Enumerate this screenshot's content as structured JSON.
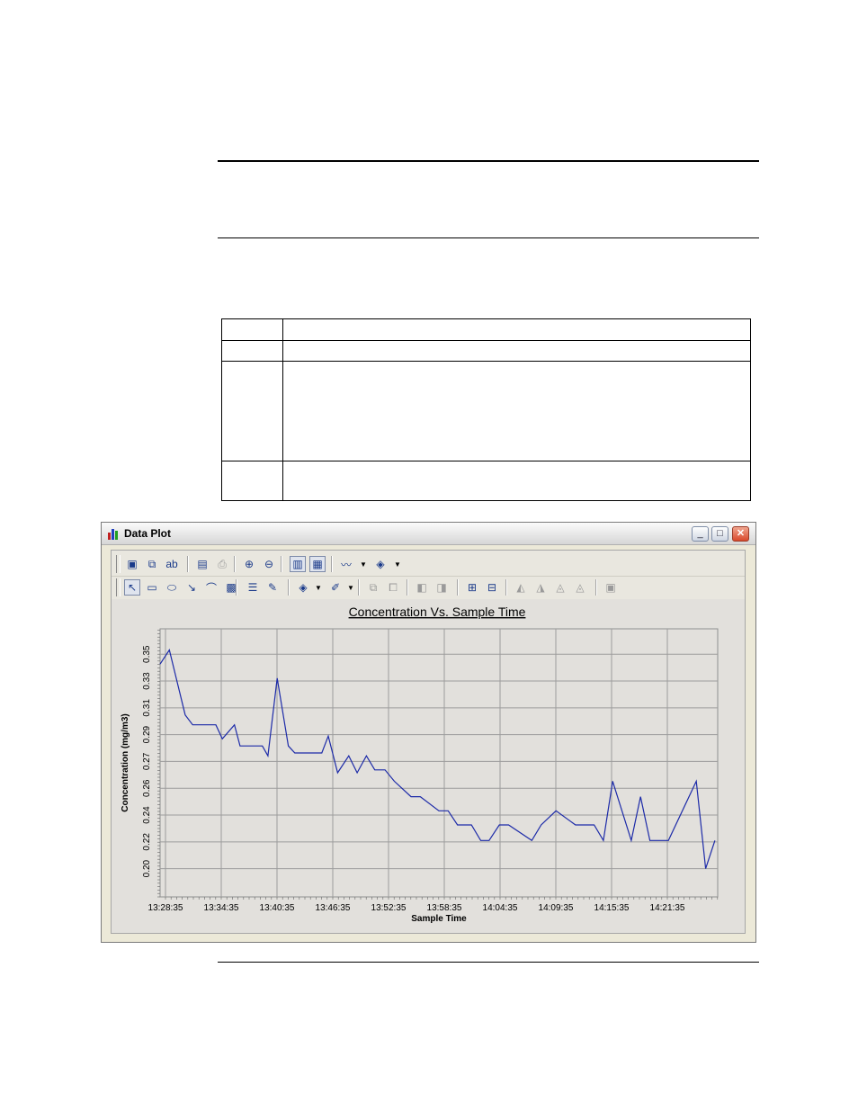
{
  "window": {
    "title": "Data Plot"
  },
  "toolbar1": [
    {
      "name": "save-icon",
      "glyph": "▣"
    },
    {
      "name": "copy-icon",
      "glyph": "⧉"
    },
    {
      "name": "text-label-icon",
      "glyph": "ab"
    },
    {
      "name": "print-preview-icon",
      "glyph": "▤"
    },
    {
      "name": "print-icon",
      "glyph": "⎙"
    },
    {
      "name": "zoom-in-icon",
      "glyph": "⊕"
    },
    {
      "name": "zoom-out-icon",
      "glyph": "⊖"
    },
    {
      "name": "chart-view-icon",
      "glyph": "▥"
    },
    {
      "name": "data-view-icon",
      "glyph": "▦"
    },
    {
      "name": "line-style-icon",
      "glyph": "〰"
    },
    {
      "name": "fill-color-icon",
      "glyph": "◈"
    }
  ],
  "toolbar2": [
    {
      "name": "pointer-icon",
      "glyph": "↖"
    },
    {
      "name": "rectangle-icon",
      "glyph": "▭"
    },
    {
      "name": "ellipse-icon",
      "glyph": "⬭"
    },
    {
      "name": "arrow-icon",
      "glyph": "↘"
    },
    {
      "name": "curve-icon",
      "glyph": "⌒"
    },
    {
      "name": "image-icon",
      "glyph": "▩"
    },
    {
      "name": "text-box-icon",
      "glyph": "☰"
    },
    {
      "name": "callout-icon",
      "glyph": "✎"
    },
    {
      "name": "paint-bucket-icon",
      "glyph": "◈"
    },
    {
      "name": "line-color-icon",
      "glyph": "✐"
    },
    {
      "name": "copy-object-icon",
      "glyph": "⧉"
    },
    {
      "name": "paste-object-icon",
      "glyph": "⧠"
    },
    {
      "name": "bring-forward-icon",
      "glyph": "◧"
    },
    {
      "name": "send-backward-icon",
      "glyph": "◨"
    },
    {
      "name": "group-icon",
      "glyph": "⊞"
    },
    {
      "name": "ungroup-icon",
      "glyph": "⊟"
    },
    {
      "name": "flip-horizontal-icon",
      "glyph": "◭"
    },
    {
      "name": "flip-vertical-icon",
      "glyph": "◮"
    },
    {
      "name": "rotate-left-icon",
      "glyph": "◬"
    },
    {
      "name": "rotate-right-icon",
      "glyph": "◬"
    },
    {
      "name": "properties-icon",
      "glyph": "▣"
    }
  ],
  "colors": {
    "line": "#1c2aa8",
    "grid": "#9c9c9c",
    "plot_bg": "#e2e0dc"
  },
  "chart_data": {
    "type": "line",
    "title": "Concentration Vs. Sample Time",
    "xlabel": "Sample Time",
    "ylabel": "Concentration (mg/m3)",
    "x_tick_labels": [
      "13:28:35",
      "13:34:35",
      "13:40:35",
      "13:46:35",
      "13:52:35",
      "13:58:35",
      "14:04:35",
      "14:09:35",
      "14:15:35",
      "14:21:35"
    ],
    "y_tick_labels": [
      "0.20",
      "0.22",
      "0.24",
      "0.26",
      "0.27",
      "0.29",
      "0.31",
      "0.33",
      "0.35"
    ],
    "y_tick_values": [
      0.2,
      0.219,
      0.238,
      0.257,
      0.276,
      0.295,
      0.314,
      0.333,
      0.352
    ],
    "ylim": [
      0.18,
      0.37
    ],
    "x_minutes_range": [
      0,
      60
    ],
    "series": [
      {
        "x": [
          0,
          1,
          2.7,
          3.5,
          6,
          6.7,
          8,
          8.6,
          11,
          11.6,
          12.6,
          13.8,
          14.5,
          15.7,
          17.4,
          18.1,
          19.1,
          20.3,
          21.2,
          22.2,
          23.1,
          24.2,
          25.2,
          27,
          28,
          30,
          31,
          32,
          33.5,
          34.5,
          35.4,
          36.5,
          37.5,
          40,
          41,
          42.6,
          44.7,
          46.7,
          47.7,
          48.7,
          50.7,
          51.7,
          52.7,
          54.7,
          57.7,
          58.7,
          59.7
        ],
        "y": [
          0.345,
          0.355,
          0.309,
          0.302,
          0.302,
          0.292,
          0.302,
          0.287,
          0.287,
          0.28,
          0.335,
          0.287,
          0.282,
          0.282,
          0.282,
          0.294,
          0.268,
          0.28,
          0.268,
          0.28,
          0.27,
          0.27,
          0.262,
          0.251,
          0.251,
          0.241,
          0.241,
          0.231,
          0.231,
          0.22,
          0.22,
          0.231,
          0.231,
          0.22,
          0.231,
          0.241,
          0.231,
          0.231,
          0.22,
          0.262,
          0.22,
          0.251,
          0.22,
          0.22,
          0.262,
          0.2,
          0.22
        ]
      }
    ]
  }
}
